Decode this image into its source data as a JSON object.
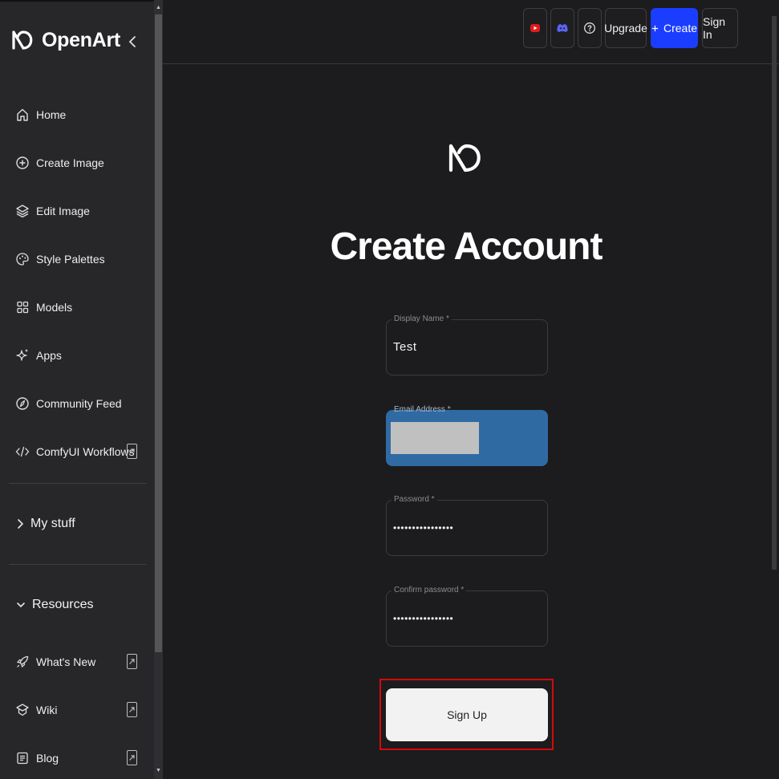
{
  "brand": {
    "name": "OpenArt"
  },
  "sidebar": {
    "items": [
      {
        "label": "Home",
        "icon": "home-icon"
      },
      {
        "label": "Create Image",
        "icon": "plus-circle-icon"
      },
      {
        "label": "Edit Image",
        "icon": "layers-icon"
      },
      {
        "label": "Style Palettes",
        "icon": "palette-icon"
      },
      {
        "label": "Models",
        "icon": "grid-icon"
      },
      {
        "label": "Apps",
        "icon": "sparkle-icon"
      },
      {
        "label": "Community Feed",
        "icon": "compass-icon"
      },
      {
        "label": "ComfyUI Workflows",
        "icon": "code-icon"
      }
    ],
    "sections": [
      {
        "label": "My stuff",
        "icon": "chevron-right-icon"
      },
      {
        "label": "Resources",
        "icon": "chevron-down-icon"
      }
    ],
    "resources": [
      {
        "label": "What's New",
        "icon": "rocket-icon"
      },
      {
        "label": "Wiki",
        "icon": "wiki-icon"
      },
      {
        "label": "Blog",
        "icon": "document-icon"
      }
    ]
  },
  "header": {
    "upgrade_label": "Upgrade",
    "create_label": "Create",
    "signin_label": "Sign In",
    "accent_color": "#1a3dff"
  },
  "form": {
    "title": "Create Account",
    "display_name": {
      "label": "Display Name *",
      "value": "Test"
    },
    "email": {
      "label": "Email Address *"
    },
    "password": {
      "label": "Password *",
      "value": "••••••••••••••••"
    },
    "confirm_password": {
      "label": "Confirm password *",
      "value": "••••••••••••••••"
    },
    "submit_label": "Sign Up"
  }
}
